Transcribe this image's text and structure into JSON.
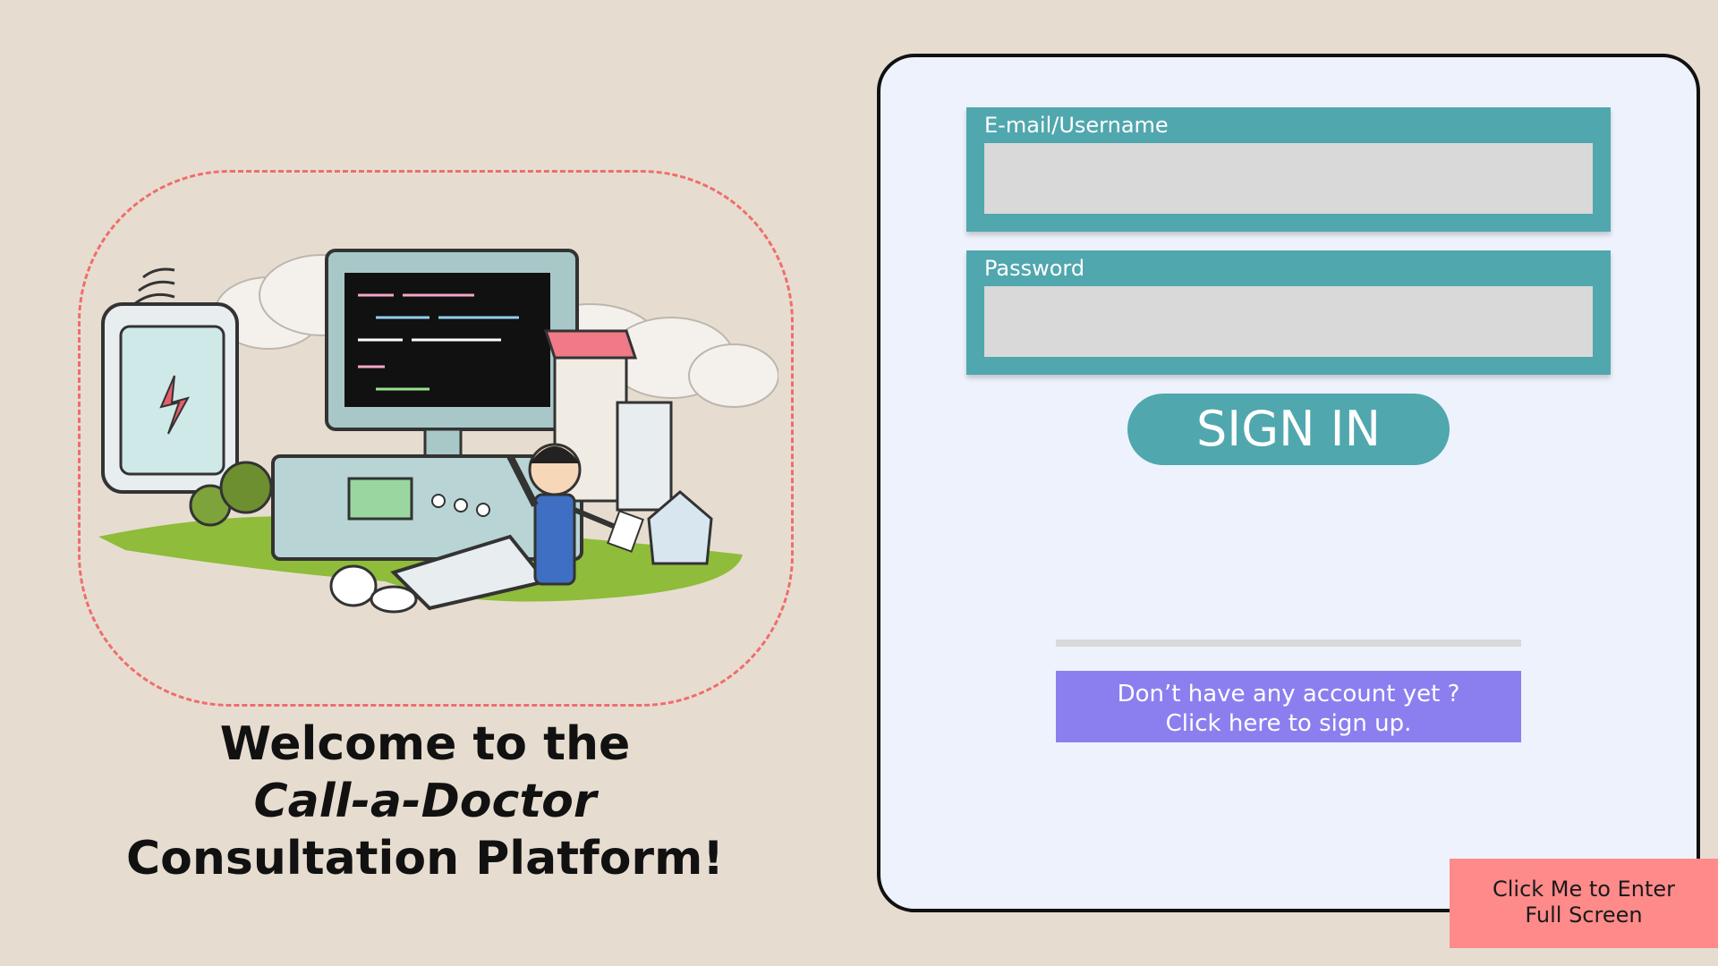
{
  "welcome": {
    "line1": "Welcome to the",
    "line2": "Call-a-Doctor",
    "line3": "Consultation Platform!"
  },
  "login": {
    "email_label": "E-mail/Username",
    "email_value": "",
    "password_label": "Password",
    "password_value": "",
    "signin_label": "SIGN IN"
  },
  "signup": {
    "line1": "Don’t have any account yet ?",
    "line2": "Click here to sign up."
  },
  "fullscreen": {
    "line1": "Click Me to Enter",
    "line2": "Full Screen"
  },
  "colors": {
    "background": "#e6ddd0",
    "panel": "#edf2fc",
    "teal": "#50a7ae",
    "signup_purple": "#8b7ff0",
    "fullscreen_pink": "#ff8a8a",
    "dashed_frame": "#f06d6d"
  },
  "illustration": {
    "icon": "computer-science-illustration"
  }
}
